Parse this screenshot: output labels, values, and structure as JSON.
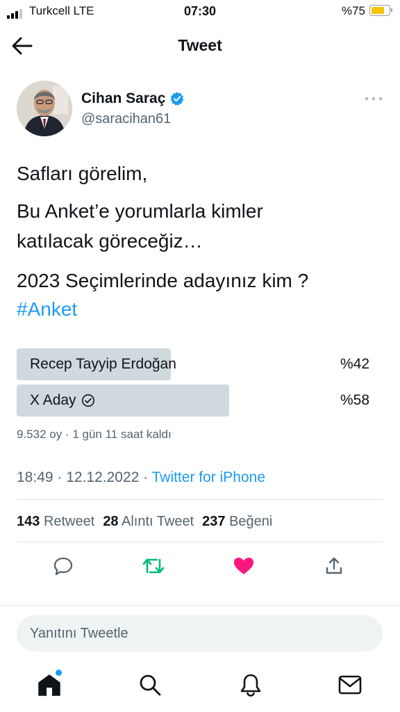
{
  "status_bar": {
    "carrier": "Turkcell  LTE",
    "time": "07:30",
    "battery": "%75",
    "battery_level": 0.75,
    "signal_bars": 3,
    "signal_bars_total": 4
  },
  "header": {
    "title": "Tweet",
    "back_icon": "arrow-left-icon"
  },
  "author": {
    "name": "Cihan Saraç",
    "handle": "@saracihan61",
    "verified_icon": "verified-badge-icon",
    "more_icon": "more-dots-icon"
  },
  "tweet": {
    "lines": [
      "Safları görelim,",
      "Bu Anket’e yorumlarla kimler",
      "katılacak göreceğiz…",
      "2023 Seçimlerinde adayınız kim ?"
    ],
    "hashtag": "#Anket"
  },
  "poll": {
    "options": [
      {
        "label": "Recep Tayyip Erdoğan",
        "percent": "%42",
        "value": 42,
        "selected": false
      },
      {
        "label": "X Aday",
        "percent": "%58",
        "value": 58,
        "selected": true
      }
    ],
    "meta": "9.532 oy · 1 gün 11 saat kaldı"
  },
  "timestamp": {
    "time_date": "18:49 · 12.12.2022 · ",
    "source": "Twitter for iPhone"
  },
  "stats": {
    "retweets": {
      "count": "143",
      "label": "Retweet"
    },
    "quotes": {
      "count": "28",
      "label": "Alıntı Tweet"
    },
    "likes": {
      "count": "237",
      "label": "Beğeni"
    }
  },
  "actions": {
    "reply_icon": "reply-icon",
    "retweet_icon": "retweet-icon",
    "like_icon": "heart-filled-icon",
    "share_icon": "share-icon",
    "retweet_color": "#00ba7c",
    "like_color": "#f91880"
  },
  "reply_box": {
    "placeholder": "Yanıtını Tweetle"
  },
  "tab_bar": {
    "items": [
      "home-icon",
      "search-icon",
      "notifications-icon",
      "messages-icon"
    ],
    "accent": "#1d9bf0"
  }
}
